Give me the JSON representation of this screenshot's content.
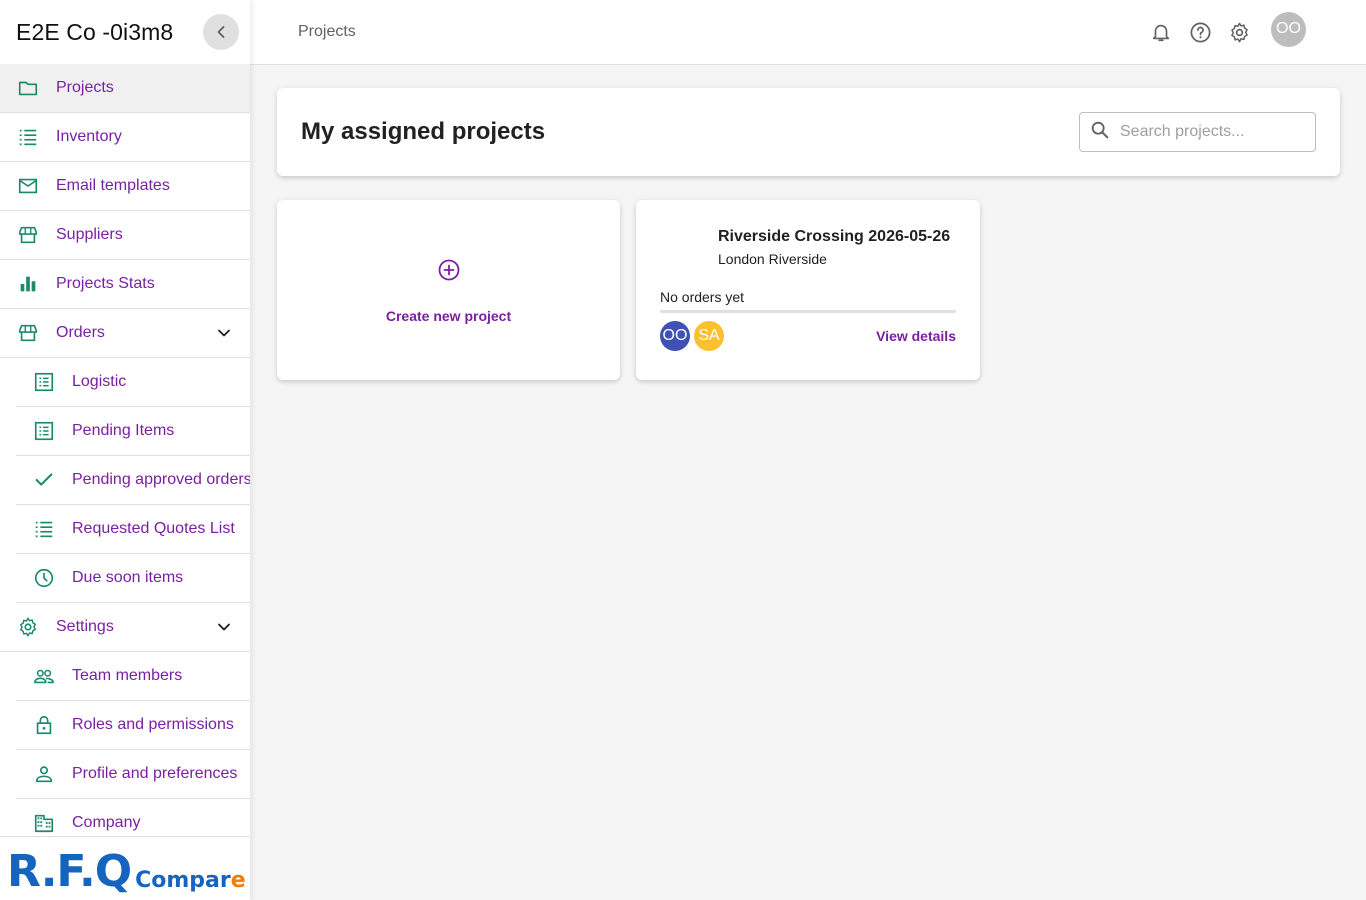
{
  "sidebar": {
    "company_name": "E2E Co -0i3m8",
    "items": [
      {
        "label": "Projects"
      },
      {
        "label": "Inventory"
      },
      {
        "label": "Email templates"
      },
      {
        "label": "Suppliers"
      },
      {
        "label": "Projects Stats"
      },
      {
        "label": "Orders"
      },
      {
        "label": "Logistic"
      },
      {
        "label": "Pending Items"
      },
      {
        "label": "Pending approved orders"
      },
      {
        "label": "Requested Quotes List"
      },
      {
        "label": "Due soon items"
      },
      {
        "label": "Settings"
      },
      {
        "label": "Team members"
      },
      {
        "label": "Roles and permissions"
      },
      {
        "label": "Profile and preferences"
      },
      {
        "label": "Company"
      }
    ],
    "logo": {
      "main": "R.F.Q",
      "sub_a": "Compar",
      "sub_b": "e"
    }
  },
  "topbar": {
    "breadcrumb": "Projects",
    "user_initials": "OO"
  },
  "main": {
    "title": "My assigned projects",
    "search_placeholder": "Search projects...",
    "create_label": "Create new project",
    "project": {
      "name": "Riverside Crossing 2026-05-26",
      "location": "London Riverside",
      "status": "No orders yet",
      "members": [
        "OO",
        "SA"
      ],
      "view_label": "View details"
    }
  },
  "colors": {
    "accent": "#7b1fa2",
    "icon": "#1b8a6b",
    "avatar_oo": "#3f51b5",
    "avatar_sa": "#fbc02d",
    "logo_blue": "#1565c0",
    "logo_orange": "#f57c00"
  }
}
